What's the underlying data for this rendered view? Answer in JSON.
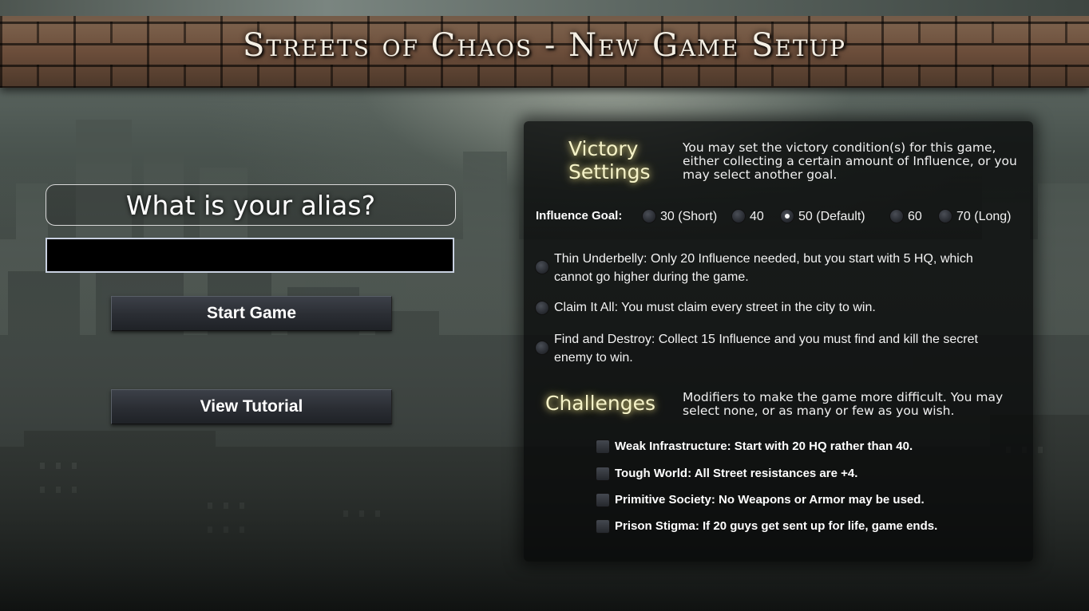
{
  "header": {
    "title": "Streets of Chaos - New Game Setup"
  },
  "alias": {
    "label": "What is your alias?",
    "value": "",
    "placeholder": ""
  },
  "buttons": {
    "start": "Start Game",
    "tutorial": "View Tutorial"
  },
  "victory": {
    "heading_line1": "Victory",
    "heading_line2": "Settings",
    "description": "You may set the victory condition(s) for this game, either collecting a certain amount of Influence, or you may select another goal.",
    "influence_label": "Influence Goal:",
    "influence_options": [
      {
        "label": "30 (Short)",
        "selected": false
      },
      {
        "label": "40",
        "selected": false
      },
      {
        "label": "50 (Default)",
        "selected": true
      },
      {
        "label": "60",
        "selected": false
      },
      {
        "label": "70 (Long)",
        "selected": false
      }
    ],
    "goals": [
      {
        "line1": "Thin Underbelly: Only 20 Influence needed, but you start with 5 HQ, which",
        "line2": "cannot go higher during the game."
      },
      {
        "line1": "Claim It All: You must claim every street in the city to win.",
        "line2": ""
      },
      {
        "line1": "Find and Destroy: Collect 15 Influence and you must find and kill the secret",
        "line2": "enemy to win."
      }
    ]
  },
  "challenges": {
    "heading": "Challenges",
    "description": "Modifiers to make the game more difficult. You may select none, or as many or few as you wish.",
    "items": [
      {
        "label": "Weak Infrastructure: Start with 20 HQ rather than 40.",
        "checked": false
      },
      {
        "label": "Tough World: All Street resistances are +4.",
        "checked": false
      },
      {
        "label": "Primitive Society: No Weapons or Armor may be used.",
        "checked": false
      },
      {
        "label": "Prison Stigma: If 20 guys get sent up for life, game ends.",
        "checked": false
      }
    ]
  },
  "colors": {
    "heading_glow": "#f5f2c8",
    "input_bg": "#000000",
    "panel_bg": "#08090a"
  }
}
